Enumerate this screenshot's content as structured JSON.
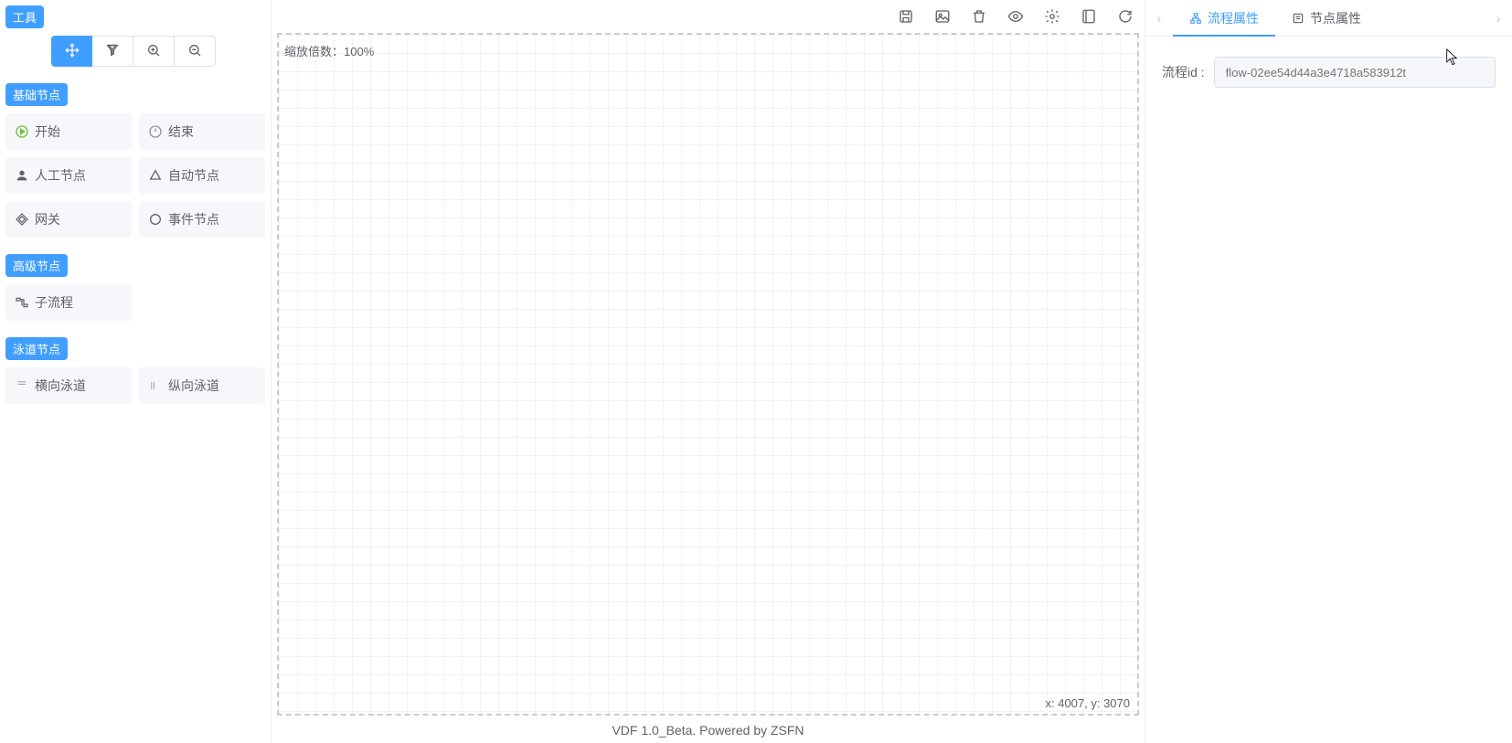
{
  "sidebar": {
    "title": "工具",
    "tool_buttons": [
      {
        "name": "move-tool",
        "active": true
      },
      {
        "name": "pointer-tool",
        "active": false
      },
      {
        "name": "zoom-in-tool",
        "active": false
      },
      {
        "name": "zoom-out-tool",
        "active": false
      }
    ],
    "sections": [
      {
        "title": "基础节点",
        "items": [
          {
            "label": "开始",
            "icon": "play-circle-icon"
          },
          {
            "label": "结束",
            "icon": "power-icon"
          },
          {
            "label": "人工节点",
            "icon": "user-icon"
          },
          {
            "label": "自动节点",
            "icon": "triangle-icon"
          },
          {
            "label": "网关",
            "icon": "diamond-icon"
          },
          {
            "label": "事件节点",
            "icon": "circle-icon"
          }
        ]
      },
      {
        "title": "高级节点",
        "items": [
          {
            "label": "子流程",
            "icon": "subflow-icon"
          }
        ]
      },
      {
        "title": "泳道节点",
        "items": [
          {
            "label": "横向泳道",
            "icon": "h-lane-icon"
          },
          {
            "label": "纵向泳道",
            "icon": "v-lane-icon"
          }
        ]
      }
    ]
  },
  "canvas": {
    "zoom_label_prefix": "缩放倍数：",
    "zoom_value": "100%",
    "coord_text": "x: 4007, y: 3070",
    "top_icons": [
      "save-icon",
      "image-icon",
      "trash-icon",
      "eye-icon",
      "gear-icon",
      "panel-icon",
      "refresh-icon"
    ]
  },
  "footer": {
    "text": "VDF 1.0_Beta. Powered by ZSFN"
  },
  "right_panel": {
    "tabs": [
      {
        "label": "流程属性",
        "icon": "flow-icon",
        "active": true
      },
      {
        "label": "节点属性",
        "icon": "node-icon",
        "active": false
      }
    ],
    "form": {
      "flow_id_label": "流程id :",
      "flow_id_placeholder": "flow-02ee54d44a3e4718a583912t"
    }
  }
}
